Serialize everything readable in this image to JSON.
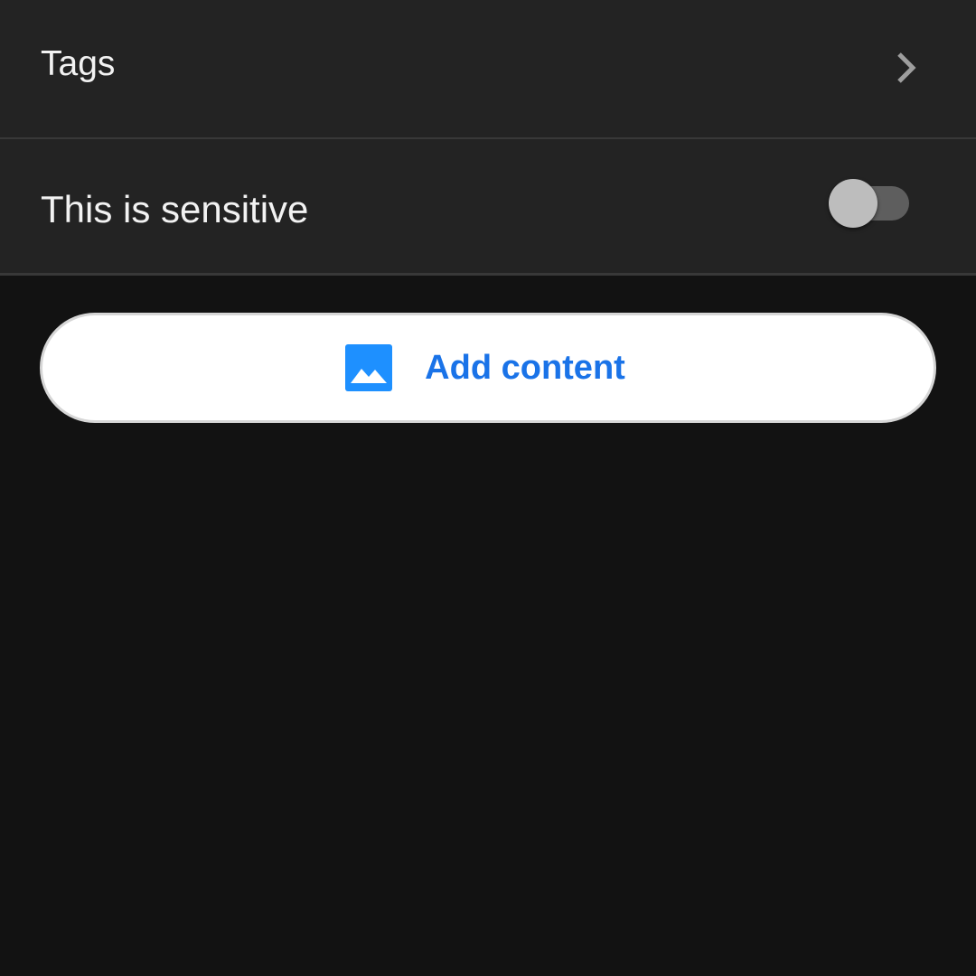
{
  "rows": {
    "tags": {
      "label": "Tags",
      "icon": "chevron-right-icon"
    },
    "sensitive": {
      "label": "This is sensitive",
      "toggle_on": false
    }
  },
  "add_button": {
    "label": "Add content",
    "icon": "image-icon",
    "accent_color": "#1a73e8",
    "icon_color": "#1e90ff"
  },
  "colors": {
    "background": "#121212",
    "row_background": "#232323",
    "divider": "#383838"
  }
}
